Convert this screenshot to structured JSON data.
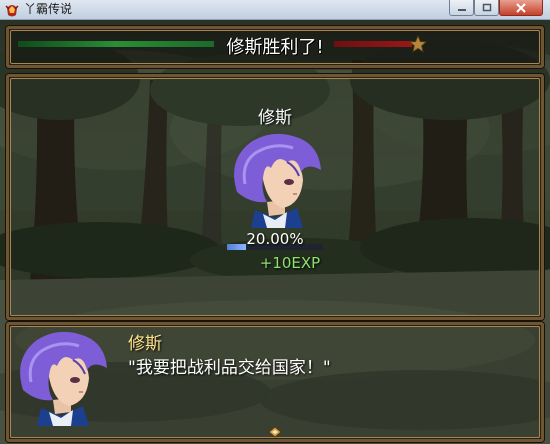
{
  "window": {
    "title": "丫霸传说",
    "icons": [
      "app-icon",
      "minimize-icon",
      "maximize-icon",
      "close-icon"
    ]
  },
  "banner": {
    "message": "修斯胜利了!",
    "icons": [
      "star-icon"
    ],
    "colors": {
      "left_bar": "#2a8f35",
      "right_bar": "#9a1718"
    }
  },
  "battle_result": {
    "actor_name": "修斯",
    "exp_percent_label": "20.00%",
    "exp_progress": 0.2,
    "exp_gain": "+10EXP",
    "colors": {
      "exp_gain": "#8ee06e",
      "exp_gauge": "#6a98ee"
    }
  },
  "dialogue": {
    "speaker": "修斯",
    "line": "\"我要把战利品交给国家！\"",
    "icons": [
      "continue-arrow-icon"
    ],
    "colors": {
      "speaker": "#ffe38a"
    }
  }
}
